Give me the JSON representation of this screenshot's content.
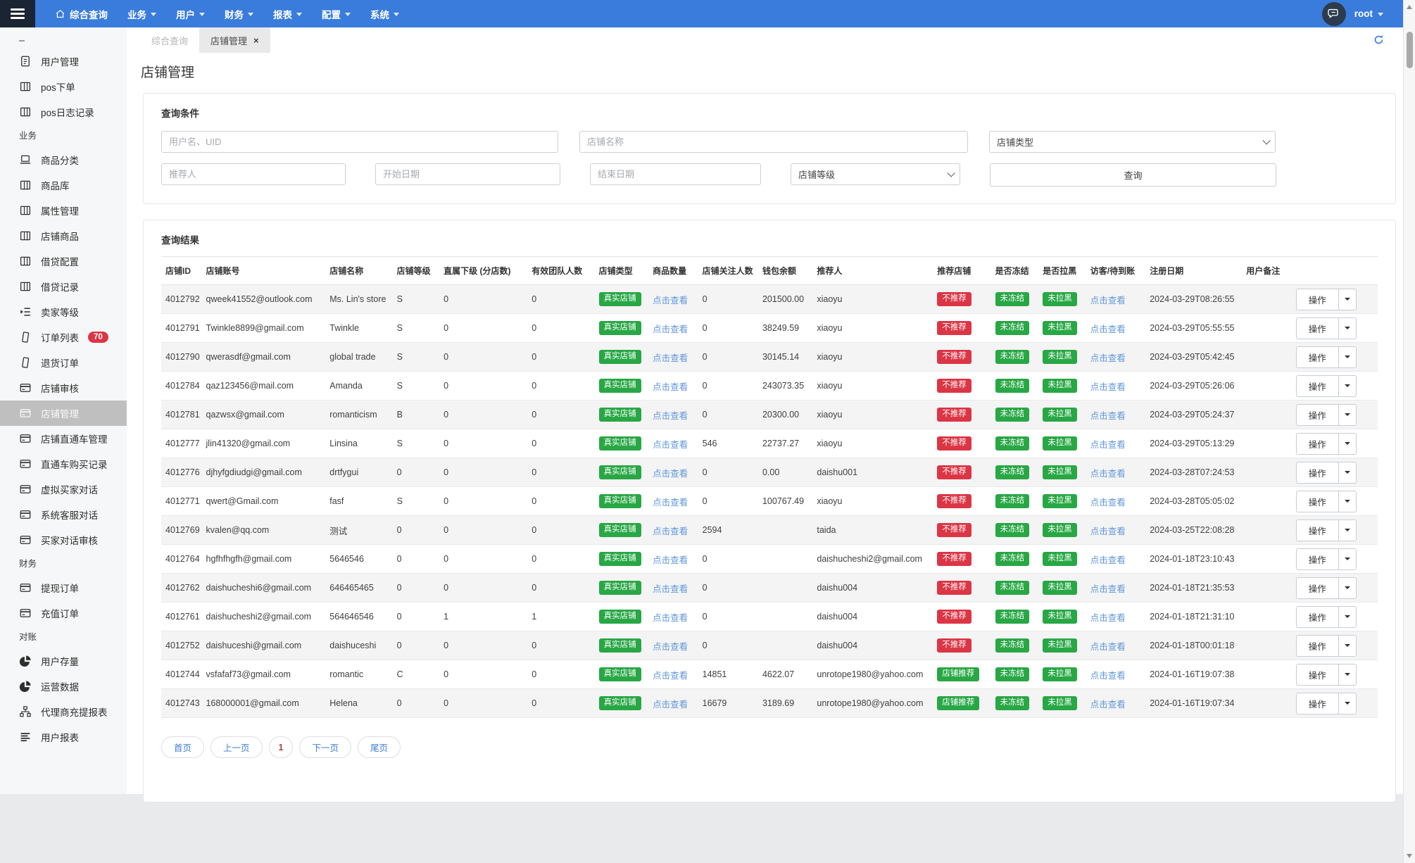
{
  "navbar": {
    "menu": [
      {
        "label": "综合查询",
        "icon": "home",
        "caret": false
      },
      {
        "label": "业务",
        "caret": true
      },
      {
        "label": "用户",
        "caret": true
      },
      {
        "label": "财务",
        "caret": true
      },
      {
        "label": "报表",
        "caret": true
      },
      {
        "label": "配置",
        "caret": true
      },
      {
        "label": "系统",
        "caret": true
      }
    ],
    "user": {
      "name": "root"
    }
  },
  "sidebar": {
    "groups": [
      {
        "label": "",
        "items": [
          {
            "label": "用户管理",
            "icon": "file-text"
          },
          {
            "label": "pos下单",
            "icon": "table"
          },
          {
            "label": "pos日志记录",
            "icon": "table"
          }
        ]
      },
      {
        "label": "业务",
        "items": [
          {
            "label": "商品分类",
            "icon": "laptop"
          },
          {
            "label": "商品库",
            "icon": "table"
          },
          {
            "label": "属性管理",
            "icon": "table"
          },
          {
            "label": "店铺商品",
            "icon": "table"
          },
          {
            "label": "借贷配置",
            "icon": "table"
          },
          {
            "label": "借贷记录",
            "icon": "table"
          },
          {
            "label": "卖家等级",
            "icon": "list-indent"
          },
          {
            "label": "订单列表",
            "icon": "file",
            "badge": "70"
          },
          {
            "label": "退货订单",
            "icon": "file"
          },
          {
            "label": "店铺审核",
            "icon": "credit-card"
          },
          {
            "label": "店铺管理",
            "icon": "credit-card",
            "active": true
          },
          {
            "label": "店铺直通车管理",
            "icon": "credit-card"
          },
          {
            "label": "直通车购买记录",
            "icon": "credit-card"
          },
          {
            "label": "虚拟买家对话",
            "icon": "credit-card"
          },
          {
            "label": "系统客服对话",
            "icon": "credit-card"
          },
          {
            "label": "买家对话审核",
            "icon": "credit-card"
          }
        ]
      },
      {
        "label": "财务",
        "items": [
          {
            "label": "提现订单",
            "icon": "credit-card"
          },
          {
            "label": "充值订单",
            "icon": "credit-card"
          }
        ]
      },
      {
        "label": "对账",
        "items": [
          {
            "label": "用户存量",
            "icon": "pie-chart"
          },
          {
            "label": "运营数据",
            "icon": "pie-chart"
          },
          {
            "label": "代理商充提报表",
            "icon": "sitemap"
          },
          {
            "label": "用户报表",
            "icon": "align-bars"
          }
        ]
      }
    ]
  },
  "tabs": [
    {
      "label": "综合查询",
      "active": false,
      "closable": false
    },
    {
      "label": "店铺管理",
      "active": true,
      "closable": true
    }
  ],
  "page": {
    "title": "店铺管理"
  },
  "filter": {
    "title": "查询条件",
    "inputs": {
      "username_placeholder": "用户名、UID",
      "shop_name_placeholder": "店铺名称",
      "shop_type_label": "店铺类型",
      "referrer_placeholder": "推荐人",
      "start_date_placeholder": "开始日期",
      "end_date_placeholder": "结束日期",
      "shop_level_label": "店铺等级",
      "search_button": "查询"
    }
  },
  "results": {
    "title": "查询结果",
    "columns": [
      "店铺ID",
      "店铺账号",
      "店铺名称",
      "店铺等级",
      "直属下级 (分店数)",
      "有效团队人数",
      "店铺类型",
      "商品数量",
      "店铺关注人数",
      "钱包余额",
      "推荐人",
      "推荐店铺",
      "是否冻结",
      "是否拉黑",
      "访客/待到账",
      "注册日期",
      "用户备注",
      ""
    ],
    "link_text": {
      "view": "点击查看"
    },
    "badges": {
      "real_shop": "真实店铺",
      "not_recommended": "不推荐",
      "recommended": "店铺推荐",
      "not_frozen": "未冻结",
      "not_blacklisted": "未拉黑"
    },
    "action_label": "操作",
    "rows": [
      {
        "id": "4012792",
        "account": "qweek41552@outlook.com",
        "name": "Ms. Lin's store",
        "level": "S",
        "direct_sub": "0",
        "team": "0",
        "followers": "0",
        "balance": "201500.00",
        "referrer": "xiaoyu",
        "recommend": "not_recommended",
        "reg_date": "2024-03-29T08:26:55",
        "remark": ""
      },
      {
        "id": "4012791",
        "account": "Twinkle8899@gmail.com",
        "name": "Twinkle",
        "level": "S",
        "direct_sub": "0",
        "team": "0",
        "followers": "0",
        "balance": "38249.59",
        "referrer": "xiaoyu",
        "recommend": "not_recommended",
        "reg_date": "2024-03-29T05:55:55",
        "remark": ""
      },
      {
        "id": "4012790",
        "account": "qwerasdf@gmail.com",
        "name": "global trade",
        "level": "S",
        "direct_sub": "0",
        "team": "0",
        "followers": "0",
        "balance": "30145.14",
        "referrer": "xiaoyu",
        "recommend": "not_recommended",
        "reg_date": "2024-03-29T05:42:45",
        "remark": ""
      },
      {
        "id": "4012784",
        "account": "qaz123456@mail.com",
        "name": "Amanda",
        "level": "S",
        "direct_sub": "0",
        "team": "0",
        "followers": "0",
        "balance": "243073.35",
        "referrer": "xiaoyu",
        "recommend": "not_recommended",
        "reg_date": "2024-03-29T05:26:06",
        "remark": ""
      },
      {
        "id": "4012781",
        "account": "qazwsx@gmail.com",
        "name": "romanticism",
        "level": "B",
        "direct_sub": "0",
        "team": "0",
        "followers": "0",
        "balance": "20300.00",
        "referrer": "xiaoyu",
        "recommend": "not_recommended",
        "reg_date": "2024-03-29T05:24:37",
        "remark": ""
      },
      {
        "id": "4012777",
        "account": "jlin41320@gmail.com",
        "name": "Linsina",
        "level": "S",
        "direct_sub": "0",
        "team": "0",
        "followers": "546",
        "balance": "22737.27",
        "referrer": "xiaoyu",
        "recommend": "not_recommended",
        "reg_date": "2024-03-29T05:13:29",
        "remark": ""
      },
      {
        "id": "4012776",
        "account": "djhyfgdiudgi@gmail.com",
        "name": "drtfygui",
        "level": "0",
        "direct_sub": "0",
        "team": "0",
        "followers": "0",
        "balance": "0.00",
        "referrer": "daishu001",
        "recommend": "not_recommended",
        "reg_date": "2024-03-28T07:24:53",
        "remark": ""
      },
      {
        "id": "4012771",
        "account": "qwert@Gmail.com",
        "name": "fasf",
        "level": "S",
        "direct_sub": "0",
        "team": "0",
        "followers": "0",
        "balance": "100767.49",
        "referrer": "xiaoyu",
        "recommend": "not_recommended",
        "reg_date": "2024-03-28T05:05:02",
        "remark": ""
      },
      {
        "id": "4012769",
        "account": "kvalen@qq.com",
        "name": "测试",
        "level": "0",
        "direct_sub": "0",
        "team": "0",
        "followers": "2594",
        "balance": "",
        "referrer": "taida",
        "recommend": "not_recommended",
        "reg_date": "2024-03-25T22:08:28",
        "remark": ""
      },
      {
        "id": "4012764",
        "account": "hgfhfhgfh@gmail.com",
        "name": "5646546",
        "level": "0",
        "direct_sub": "0",
        "team": "0",
        "followers": "0",
        "balance": "",
        "referrer": "daishucheshi2@gmail.com",
        "recommend": "not_recommended",
        "reg_date": "2024-01-18T23:10:43",
        "remark": ""
      },
      {
        "id": "4012762",
        "account": "daishucheshi6@gmail.com",
        "name": "646465465",
        "level": "0",
        "direct_sub": "0",
        "team": "0",
        "followers": "0",
        "balance": "",
        "referrer": "daishu004",
        "recommend": "not_recommended",
        "reg_date": "2024-01-18T21:35:53",
        "remark": ""
      },
      {
        "id": "4012761",
        "account": "daishucheshi2@gmail.com",
        "name": "564646546",
        "level": "0",
        "direct_sub": "1",
        "team": "1",
        "followers": "0",
        "balance": "",
        "referrer": "daishu004",
        "recommend": "not_recommended",
        "reg_date": "2024-01-18T21:31:10",
        "remark": ""
      },
      {
        "id": "4012752",
        "account": "daishuceshi@gmail.com",
        "name": "daishuceshi",
        "level": "0",
        "direct_sub": "0",
        "team": "0",
        "followers": "0",
        "balance": "",
        "referrer": "daishu004",
        "recommend": "not_recommended",
        "reg_date": "2024-01-18T00:01:18",
        "remark": ""
      },
      {
        "id": "4012744",
        "account": "vsfafaf73@gmail.com",
        "name": "romantic",
        "level": "C",
        "direct_sub": "0",
        "team": "0",
        "followers": "14851",
        "balance": "4622.07",
        "referrer": "unrotope1980@yahoo.com",
        "recommend": "recommended",
        "reg_date": "2024-01-16T19:07:38",
        "remark": ""
      },
      {
        "id": "4012743",
        "account": "168000001@gmail.com",
        "name": "Helena",
        "level": "0",
        "direct_sub": "0",
        "team": "0",
        "followers": "16679",
        "balance": "3189.69",
        "referrer": "unrotope1980@yahoo.com",
        "recommend": "recommended",
        "reg_date": "2024-01-16T19:07:34",
        "remark": ""
      }
    ]
  },
  "pagination": {
    "items": [
      {
        "label": "首页"
      },
      {
        "label": "上一页"
      },
      {
        "label": "1",
        "current": true
      },
      {
        "label": "下一页"
      },
      {
        "label": "尾页"
      }
    ]
  },
  "colors": {
    "navbar_bg": "#3A7CDB",
    "accent": "#3B7DDD",
    "badge_green": "#28a745",
    "badge_red": "#dc3545",
    "link_blue": "#5f96db",
    "link_strong": "#3f7fd6",
    "page_current_red": "#a94442"
  }
}
